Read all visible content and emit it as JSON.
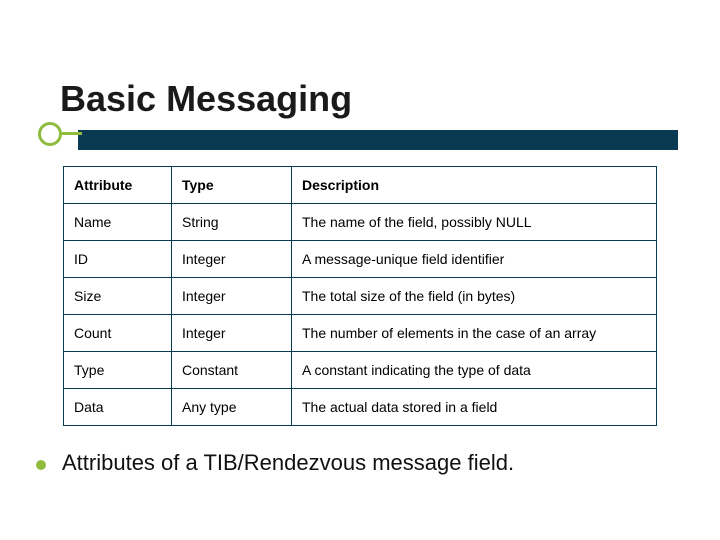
{
  "title": "Basic Messaging",
  "table": {
    "headers": {
      "attribute": "Attribute",
      "type": "Type",
      "description": "Description"
    },
    "rows": [
      {
        "attribute": "Name",
        "type": "String",
        "description": "The name of the field, possibly NULL"
      },
      {
        "attribute": "ID",
        "type": "Integer",
        "description": "A message-unique field identifier"
      },
      {
        "attribute": "Size",
        "type": "Integer",
        "description": "The total size of the field (in bytes)"
      },
      {
        "attribute": "Count",
        "type": "Integer",
        "description": "The number of elements in the case of an array"
      },
      {
        "attribute": "Type",
        "type": "Constant",
        "description": "A constant indicating the type of data"
      },
      {
        "attribute": "Data",
        "type": "Any type",
        "description": "The actual data stored in a field"
      }
    ]
  },
  "caption": "Attributes of a TIB/Rendezvous message field.",
  "colors": {
    "accent_dark": "#0a3a52",
    "accent_green": "#8fbc3f"
  }
}
